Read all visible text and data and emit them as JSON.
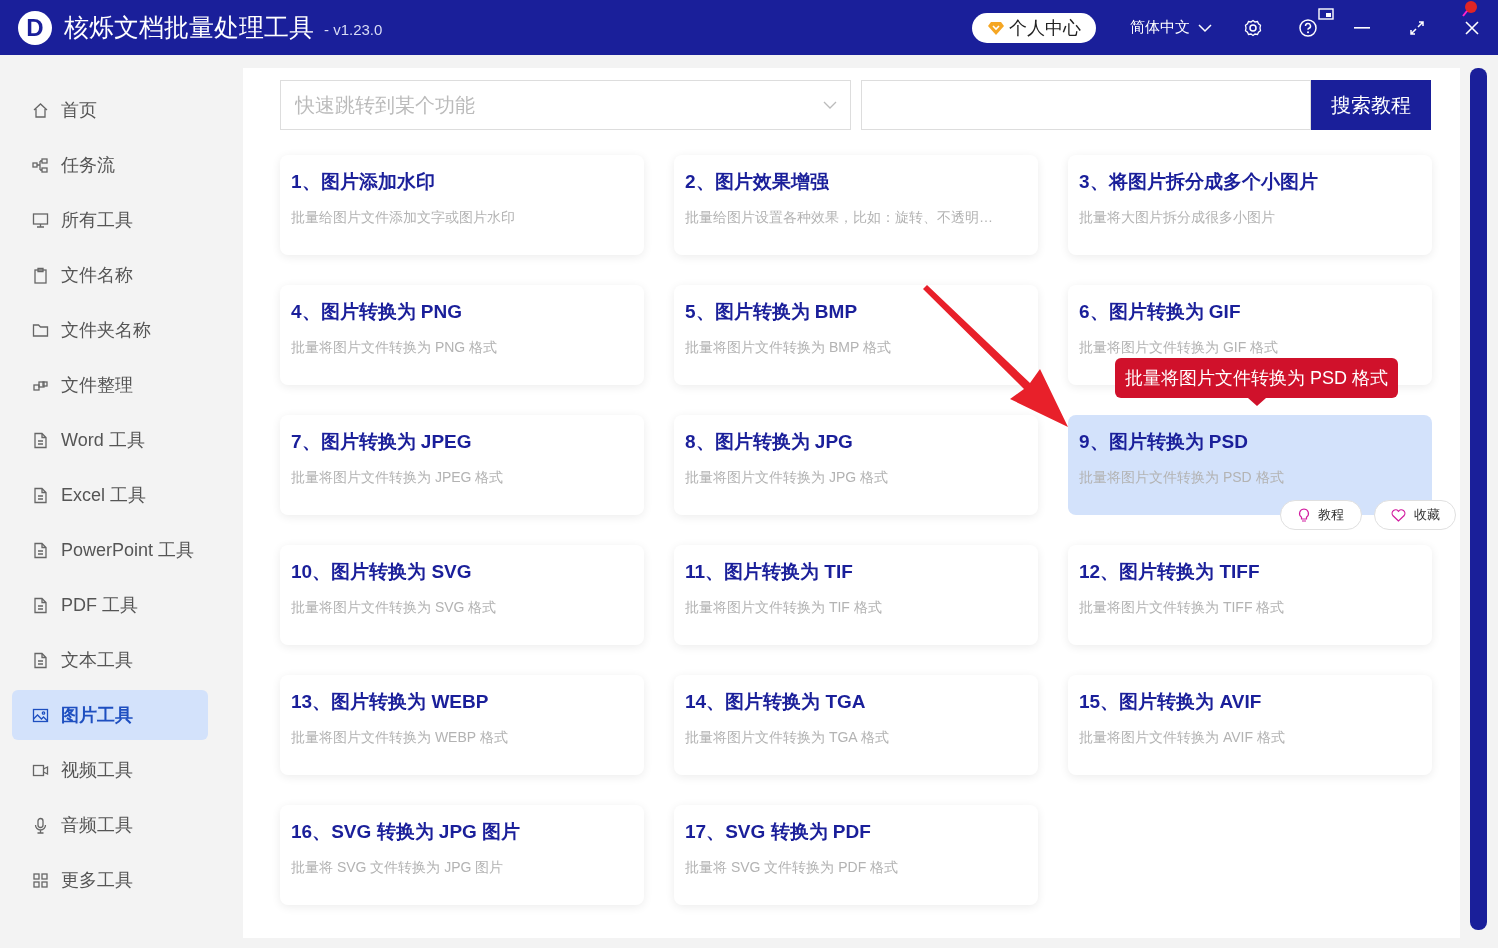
{
  "app": {
    "logo_letter": "D",
    "title": "核烁文档批量处理工具",
    "version": "- v1.23.0"
  },
  "header": {
    "user_button": "个人中心",
    "language": "简体中文"
  },
  "sidebar": {
    "items": [
      {
        "label": "首页",
        "selected": false
      },
      {
        "label": "任务流",
        "selected": false
      },
      {
        "label": "所有工具",
        "selected": false
      },
      {
        "label": "文件名称",
        "selected": false
      },
      {
        "label": "文件夹名称",
        "selected": false
      },
      {
        "label": "文件整理",
        "selected": false
      },
      {
        "label": "Word 工具",
        "selected": false
      },
      {
        "label": "Excel 工具",
        "selected": false
      },
      {
        "label": "PowerPoint 工具",
        "selected": false
      },
      {
        "label": "PDF 工具",
        "selected": false
      },
      {
        "label": "文本工具",
        "selected": false
      },
      {
        "label": "图片工具",
        "selected": true
      },
      {
        "label": "视频工具",
        "selected": false
      },
      {
        "label": "音频工具",
        "selected": false
      },
      {
        "label": "更多工具",
        "selected": false
      }
    ]
  },
  "search": {
    "placeholder": "快速跳转到某个功能",
    "button": "搜索教程"
  },
  "tools": [
    {
      "title": "1、图片添加水印",
      "description": "批量给图片文件添加文字或图片水印",
      "selected": false
    },
    {
      "title": "2、图片效果增强",
      "description": "批量给图片设置各种效果，比如：旋转、不透明…",
      "selected": false
    },
    {
      "title": "3、将图片拆分成多个小图片",
      "description": "批量将大图片拆分成很多小图片",
      "selected": false
    },
    {
      "title": "4、图片转换为 PNG",
      "description": "批量将图片文件转换为 PNG 格式",
      "selected": false
    },
    {
      "title": "5、图片转换为 BMP",
      "description": "批量将图片文件转换为 BMP 格式",
      "selected": false
    },
    {
      "title": "6、图片转换为 GIF",
      "description": "批量将图片文件转换为 GIF 格式",
      "selected": false
    },
    {
      "title": "7、图片转换为 JPEG",
      "description": "批量将图片文件转换为 JPEG 格式",
      "selected": false
    },
    {
      "title": "8、图片转换为 JPG",
      "description": "批量将图片文件转换为 JPG 格式",
      "selected": false
    },
    {
      "title": "9、图片转换为 PSD",
      "description": "批量将图片文件转换为 PSD 格式",
      "selected": true
    },
    {
      "title": "10、图片转换为 SVG",
      "description": "批量将图片文件转换为 SVG 格式",
      "selected": false
    },
    {
      "title": "11、图片转换为 TIF",
      "description": "批量将图片文件转换为 TIF 格式",
      "selected": false
    },
    {
      "title": "12、图片转换为 TIFF",
      "description": "批量将图片文件转换为 TIFF 格式",
      "selected": false
    },
    {
      "title": "13、图片转换为 WEBP",
      "description": "批量将图片文件转换为 WEBP 格式",
      "selected": false
    },
    {
      "title": "14、图片转换为 TGA",
      "description": "批量将图片文件转换为 TGA 格式",
      "selected": false
    },
    {
      "title": "15、图片转换为 AVIF",
      "description": "批量将图片文件转换为 AVIF 格式",
      "selected": false
    },
    {
      "title": "16、SVG 转换为 JPG 图片",
      "description": "批量将 SVG 文件转换为 JPG 图片",
      "selected": false
    },
    {
      "title": "17、SVG 转换为 PDF",
      "description": "批量将 SVG 文件转换为 PDF 格式",
      "selected": false
    }
  ],
  "tooltip": "批量将图片文件转换为 PSD 格式",
  "card_actions": [
    "教程",
    "收藏"
  ]
}
